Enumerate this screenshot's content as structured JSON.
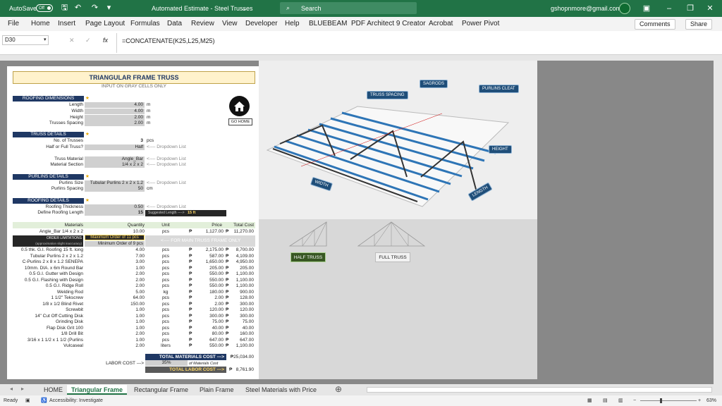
{
  "titlebar": {
    "autosave": "AutoSave",
    "autosave_state": "Off",
    "doc_title": "Automated Estimate - Steel Trusses",
    "search_placeholder": "Search",
    "user": "gshopnmore@gmail.com"
  },
  "menu": [
    "File",
    "Home",
    "Insert",
    "Page Layout",
    "Formulas",
    "Data",
    "Review",
    "View",
    "Developer",
    "Help",
    "BLUEBEAM",
    "PDF Architect 9 Creator",
    "Acrobat",
    "Power Pivot"
  ],
  "ribbon": {
    "comments": "Comments",
    "share": "Share"
  },
  "formula": {
    "namebox": "D30",
    "fx": "fx",
    "content": "=CONCATENATE(K25,L25,M25)"
  },
  "sheet": {
    "title": "TRIANGULAR FRAME TRUSS",
    "subtitle": "INPUT ON GRAY CELLS ONLY",
    "go_home": "GO HOME",
    "roofing_dims": {
      "header": "ROOFING DIMENSIONS",
      "rows": [
        [
          "Length",
          "4.00",
          "m"
        ],
        [
          "Width",
          "4.00",
          "m"
        ],
        [
          "Height",
          "2.00",
          "m"
        ],
        [
          "Trusses Spacing",
          "2.00",
          "m"
        ]
      ]
    },
    "truss_details": {
      "header": "TRUSS DETAILS",
      "rows": [
        [
          "No. of Trusses",
          "3",
          "pcs"
        ],
        [
          "Half or Full Truss?",
          "Half",
          "<---- Dropdown List"
        ],
        [
          "Truss Material",
          "Angle_Bar",
          "<---- Dropdown List"
        ],
        [
          "Material Section",
          "1/4 x 2 x 2",
          "<---- Dropdown List"
        ]
      ]
    },
    "purlins_details": {
      "header": "PURLINS DETAILS",
      "rows": [
        [
          "Purlins Size",
          "Tubular Purlins  2 x 2 x 1.2",
          "<---- Dropdown List"
        ],
        [
          "Purlins Spacing",
          "50",
          "cm"
        ]
      ]
    },
    "roofing_details": {
      "header": "ROOFING DETAILS",
      "rows": [
        [
          "Roofing Thickness",
          "0.50",
          "<---- Dropdown List"
        ],
        [
          "Define Roofing Length",
          "15",
          ""
        ]
      ],
      "suggested": "Suggested Length ---->",
      "suggested_val": "15 ft"
    },
    "table_headers": [
      "Materials",
      "Quantity",
      "Unit",
      "Price",
      "Total Cost"
    ],
    "first_row": [
      "Angle_Bar 1/4 x 2 x 2",
      "10.00",
      "pcs",
      "₱",
      "1,127.00",
      "₱",
      "11,270.00"
    ],
    "order_lim": "ORDER LIMITATIONS",
    "order_lim_note": "(approximation slight inaccuracy)",
    "max_order": "Maximum Order of 11 pcs",
    "min_order": "Minimum Order of 9 pcs",
    "main_note": "<---- FOR MAIN TRUSS FRAME ONLY",
    "materials": [
      [
        "0.5  thk. G.I. Roofing 15  ft. long",
        "4.00",
        "pcs",
        "2,175.00",
        "8,700.00"
      ],
      [
        "Tubular Purlins  2 x 2 x 1.2",
        "7.00",
        "pcs",
        "587.00",
        "4,109.00"
      ],
      [
        "C-Purlins 2 x 8 x 1.2  SENEPA",
        "3.00",
        "pcs",
        "1,650.00",
        "4,950.00"
      ],
      [
        "10mm. DIA. x 6m Round Bar",
        "1.00",
        "pcs",
        "205.00",
        "205.00"
      ],
      [
        "0.5 G.I. Gutter with Design",
        "2.00",
        "pcs",
        "550.00",
        "1,100.00"
      ],
      [
        "0.5 G.I. Flashing with Design",
        "2.00",
        "pcs",
        "550.00",
        "1,100.00"
      ],
      [
        "0.5 G.I. Ridge Roll",
        "2.00",
        "pcs",
        "550.00",
        "1,100.00"
      ],
      [
        "Welding Rod",
        "5.00",
        "kg",
        "180.00",
        "900.00"
      ],
      [
        "1 1/2\" Tekscrew",
        "64.00",
        "pcs",
        "2.00",
        "128.00"
      ],
      [
        "1/8 x 1/2 Blind Rivet",
        "150.00",
        "pcs",
        "2.00",
        "300.00"
      ],
      [
        "Screwbit",
        "1.00",
        "pcs",
        "120.00",
        "120.00"
      ],
      [
        "14\" Cut Off Cutting Disk",
        "1.00",
        "pcs",
        "300.00",
        "300.00"
      ],
      [
        "Grinding Disk",
        "1.00",
        "pcs",
        "75.00",
        "75.00"
      ],
      [
        "Flap Disk Grit 100",
        "1.00",
        "pcs",
        "40.00",
        "40.00"
      ],
      [
        "1/8 Drill Bit",
        "2.00",
        "pcs",
        "80.00",
        "160.00"
      ],
      [
        "3/16 x 1 1/2 x 1 1/2 (Purlins",
        "1.00",
        "pcs",
        "647.00",
        "647.00"
      ],
      [
        "Vulcaseal",
        "2.00",
        "liters",
        "550.00",
        "1,100.00"
      ]
    ],
    "peso": "₱",
    "total_materials_label": "TOTAL MATERIALS COST --->",
    "total_materials": "₱25,034.00",
    "labor_label": "LABOR COST --->",
    "labor_pct": "35%",
    "labor_pct_note": "of Materials Cost",
    "total_labor_label": "TOTAL LABOR COST --->",
    "total_labor": "₱",
    "total_labor_val": "8,761.90"
  },
  "diagram": {
    "truss_spacing": "TRUSS SPACING",
    "sagrods": "SAGRODS",
    "purlins_cleat": "PURLINS CLEAT",
    "height": "HEIGHT",
    "width": "WIDTH",
    "length": "LENGTH",
    "half_truss": "HALF TRUSS",
    "full_truss": "FULL TRUSS"
  },
  "tabs": [
    "HOME",
    "Triangular Frame",
    "Rectangular Frame",
    "Plain Frame",
    "Steel Materials with Price"
  ],
  "status": {
    "ready": "Ready",
    "accessibility": "Accessibility: Investigate",
    "zoom": "63%"
  }
}
